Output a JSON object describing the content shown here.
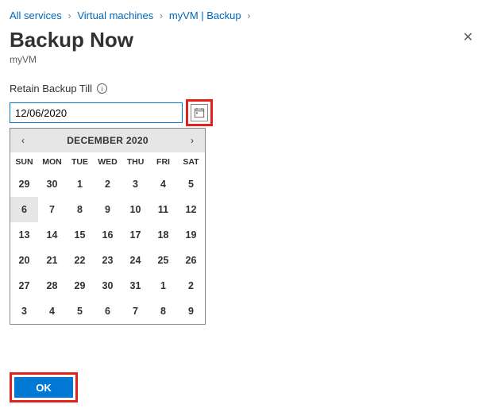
{
  "breadcrumb": {
    "items": [
      {
        "label": "All services"
      },
      {
        "label": "Virtual machines"
      },
      {
        "label": "myVM | Backup"
      }
    ]
  },
  "title": "Backup Now",
  "subtitle": "myVM",
  "field": {
    "label": "Retain Backup Till",
    "value": "12/06/2020"
  },
  "calendar": {
    "month_label": "DECEMBER 2020",
    "weekdays": [
      "SUN",
      "MON",
      "TUE",
      "WED",
      "THU",
      "FRI",
      "SAT"
    ],
    "selected_day": 6,
    "weeks": [
      [
        {
          "d": 29,
          "o": true
        },
        {
          "d": 30,
          "o": true
        },
        {
          "d": 1
        },
        {
          "d": 2
        },
        {
          "d": 3
        },
        {
          "d": 4
        },
        {
          "d": 5
        }
      ],
      [
        {
          "d": 6,
          "sel": true
        },
        {
          "d": 7
        },
        {
          "d": 8
        },
        {
          "d": 9
        },
        {
          "d": 10
        },
        {
          "d": 11
        },
        {
          "d": 12
        }
      ],
      [
        {
          "d": 13
        },
        {
          "d": 14
        },
        {
          "d": 15
        },
        {
          "d": 16
        },
        {
          "d": 17
        },
        {
          "d": 18
        },
        {
          "d": 19
        }
      ],
      [
        {
          "d": 20
        },
        {
          "d": 21
        },
        {
          "d": 22
        },
        {
          "d": 23
        },
        {
          "d": 24
        },
        {
          "d": 25
        },
        {
          "d": 26
        }
      ],
      [
        {
          "d": 27
        },
        {
          "d": 28
        },
        {
          "d": 29
        },
        {
          "d": 30
        },
        {
          "d": 31
        },
        {
          "d": 1,
          "o": true
        },
        {
          "d": 2,
          "o": true
        }
      ],
      [
        {
          "d": 3,
          "o": true
        },
        {
          "d": 4,
          "o": true
        },
        {
          "d": 5,
          "o": true
        },
        {
          "d": 6,
          "o": true
        },
        {
          "d": 7,
          "o": true
        },
        {
          "d": 8,
          "o": true
        },
        {
          "d": 9,
          "o": true
        }
      ]
    ]
  },
  "buttons": {
    "ok": "OK"
  }
}
